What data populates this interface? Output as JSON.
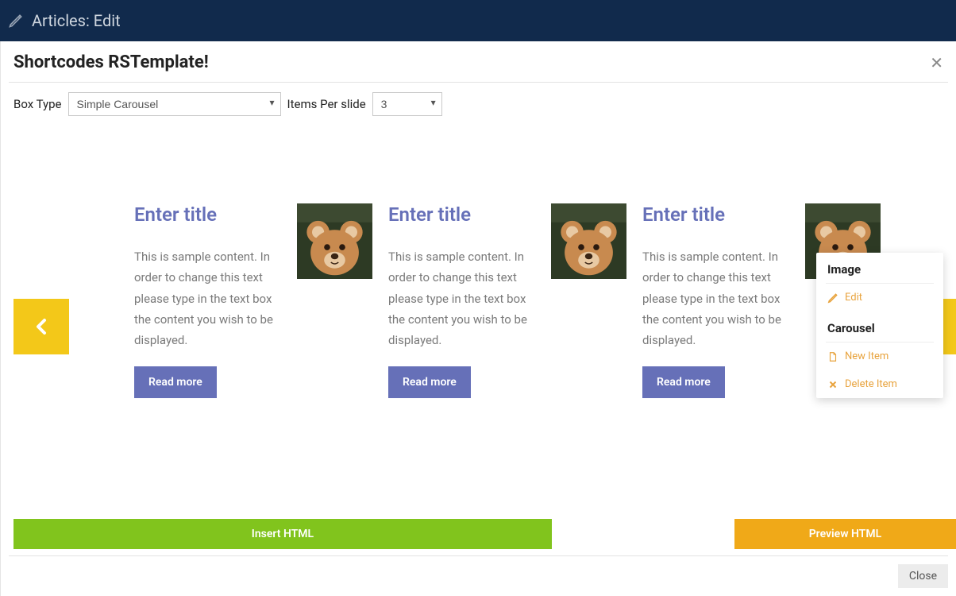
{
  "header": {
    "page_title": "Articles: Edit"
  },
  "modal": {
    "title": "Shortcodes RSTemplate!",
    "controls": {
      "box_type_label": "Box Type",
      "box_type_value": "Simple Carousel",
      "items_per_slide_label": "Items Per slide",
      "items_per_slide_value": "3"
    },
    "items": [
      {
        "title": "Enter title",
        "text": "This is sample content. In order to change this text please type in the text box the content you wish to be displayed.",
        "button": "Read more"
      },
      {
        "title": "Enter title",
        "text": "This is sample content. In order to change this text please type in the text box the content you wish to be displayed.",
        "button": "Read more"
      },
      {
        "title": "Enter title",
        "text": "This is sample content. In order to change this text please type in the text box the content you wish to be displayed.",
        "button": "Read more"
      }
    ],
    "context_menu": {
      "section1_title": "Image",
      "edit_label": "Edit",
      "section2_title": "Carousel",
      "new_item_label": "New Item",
      "delete_item_label": "Delete Item"
    },
    "actions": {
      "insert_label": "Insert HTML",
      "preview_label": "Preview HTML",
      "close_label": "Close"
    }
  }
}
